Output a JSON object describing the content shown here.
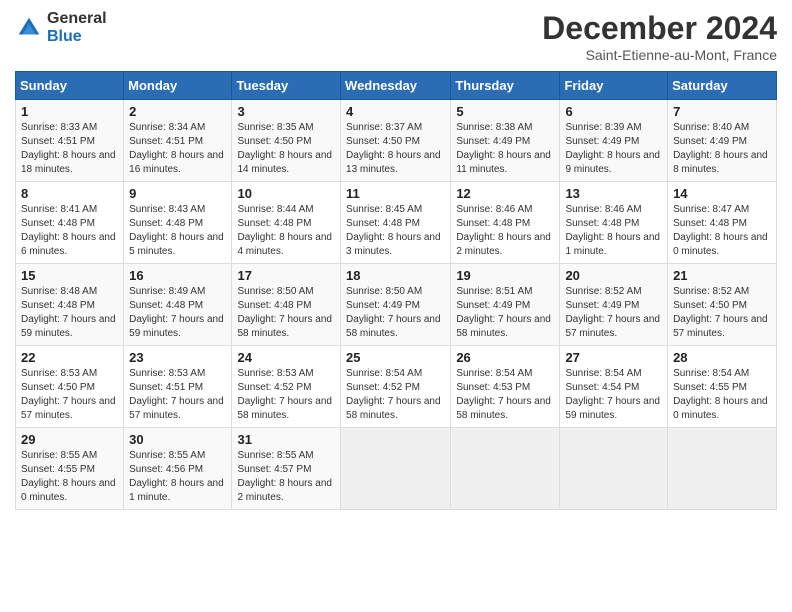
{
  "header": {
    "logo_general": "General",
    "logo_blue": "Blue",
    "month": "December 2024",
    "location": "Saint-Etienne-au-Mont, France"
  },
  "weekdays": [
    "Sunday",
    "Monday",
    "Tuesday",
    "Wednesday",
    "Thursday",
    "Friday",
    "Saturday"
  ],
  "weeks": [
    [
      {
        "day": "1",
        "sunrise": "Sunrise: 8:33 AM",
        "sunset": "Sunset: 4:51 PM",
        "daylight": "Daylight: 8 hours and 18 minutes."
      },
      {
        "day": "2",
        "sunrise": "Sunrise: 8:34 AM",
        "sunset": "Sunset: 4:51 PM",
        "daylight": "Daylight: 8 hours and 16 minutes."
      },
      {
        "day": "3",
        "sunrise": "Sunrise: 8:35 AM",
        "sunset": "Sunset: 4:50 PM",
        "daylight": "Daylight: 8 hours and 14 minutes."
      },
      {
        "day": "4",
        "sunrise": "Sunrise: 8:37 AM",
        "sunset": "Sunset: 4:50 PM",
        "daylight": "Daylight: 8 hours and 13 minutes."
      },
      {
        "day": "5",
        "sunrise": "Sunrise: 8:38 AM",
        "sunset": "Sunset: 4:49 PM",
        "daylight": "Daylight: 8 hours and 11 minutes."
      },
      {
        "day": "6",
        "sunrise": "Sunrise: 8:39 AM",
        "sunset": "Sunset: 4:49 PM",
        "daylight": "Daylight: 8 hours and 9 minutes."
      },
      {
        "day": "7",
        "sunrise": "Sunrise: 8:40 AM",
        "sunset": "Sunset: 4:49 PM",
        "daylight": "Daylight: 8 hours and 8 minutes."
      }
    ],
    [
      {
        "day": "8",
        "sunrise": "Sunrise: 8:41 AM",
        "sunset": "Sunset: 4:48 PM",
        "daylight": "Daylight: 8 hours and 6 minutes."
      },
      {
        "day": "9",
        "sunrise": "Sunrise: 8:43 AM",
        "sunset": "Sunset: 4:48 PM",
        "daylight": "Daylight: 8 hours and 5 minutes."
      },
      {
        "day": "10",
        "sunrise": "Sunrise: 8:44 AM",
        "sunset": "Sunset: 4:48 PM",
        "daylight": "Daylight: 8 hours and 4 minutes."
      },
      {
        "day": "11",
        "sunrise": "Sunrise: 8:45 AM",
        "sunset": "Sunset: 4:48 PM",
        "daylight": "Daylight: 8 hours and 3 minutes."
      },
      {
        "day": "12",
        "sunrise": "Sunrise: 8:46 AM",
        "sunset": "Sunset: 4:48 PM",
        "daylight": "Daylight: 8 hours and 2 minutes."
      },
      {
        "day": "13",
        "sunrise": "Sunrise: 8:46 AM",
        "sunset": "Sunset: 4:48 PM",
        "daylight": "Daylight: 8 hours and 1 minute."
      },
      {
        "day": "14",
        "sunrise": "Sunrise: 8:47 AM",
        "sunset": "Sunset: 4:48 PM",
        "daylight": "Daylight: 8 hours and 0 minutes."
      }
    ],
    [
      {
        "day": "15",
        "sunrise": "Sunrise: 8:48 AM",
        "sunset": "Sunset: 4:48 PM",
        "daylight": "Daylight: 7 hours and 59 minutes."
      },
      {
        "day": "16",
        "sunrise": "Sunrise: 8:49 AM",
        "sunset": "Sunset: 4:48 PM",
        "daylight": "Daylight: 7 hours and 59 minutes."
      },
      {
        "day": "17",
        "sunrise": "Sunrise: 8:50 AM",
        "sunset": "Sunset: 4:48 PM",
        "daylight": "Daylight: 7 hours and 58 minutes."
      },
      {
        "day": "18",
        "sunrise": "Sunrise: 8:50 AM",
        "sunset": "Sunset: 4:49 PM",
        "daylight": "Daylight: 7 hours and 58 minutes."
      },
      {
        "day": "19",
        "sunrise": "Sunrise: 8:51 AM",
        "sunset": "Sunset: 4:49 PM",
        "daylight": "Daylight: 7 hours and 58 minutes."
      },
      {
        "day": "20",
        "sunrise": "Sunrise: 8:52 AM",
        "sunset": "Sunset: 4:49 PM",
        "daylight": "Daylight: 7 hours and 57 minutes."
      },
      {
        "day": "21",
        "sunrise": "Sunrise: 8:52 AM",
        "sunset": "Sunset: 4:50 PM",
        "daylight": "Daylight: 7 hours and 57 minutes."
      }
    ],
    [
      {
        "day": "22",
        "sunrise": "Sunrise: 8:53 AM",
        "sunset": "Sunset: 4:50 PM",
        "daylight": "Daylight: 7 hours and 57 minutes."
      },
      {
        "day": "23",
        "sunrise": "Sunrise: 8:53 AM",
        "sunset": "Sunset: 4:51 PM",
        "daylight": "Daylight: 7 hours and 57 minutes."
      },
      {
        "day": "24",
        "sunrise": "Sunrise: 8:53 AM",
        "sunset": "Sunset: 4:52 PM",
        "daylight": "Daylight: 7 hours and 58 minutes."
      },
      {
        "day": "25",
        "sunrise": "Sunrise: 8:54 AM",
        "sunset": "Sunset: 4:52 PM",
        "daylight": "Daylight: 7 hours and 58 minutes."
      },
      {
        "day": "26",
        "sunrise": "Sunrise: 8:54 AM",
        "sunset": "Sunset: 4:53 PM",
        "daylight": "Daylight: 7 hours and 58 minutes."
      },
      {
        "day": "27",
        "sunrise": "Sunrise: 8:54 AM",
        "sunset": "Sunset: 4:54 PM",
        "daylight": "Daylight: 7 hours and 59 minutes."
      },
      {
        "day": "28",
        "sunrise": "Sunrise: 8:54 AM",
        "sunset": "Sunset: 4:55 PM",
        "daylight": "Daylight: 8 hours and 0 minutes."
      }
    ],
    [
      {
        "day": "29",
        "sunrise": "Sunrise: 8:55 AM",
        "sunset": "Sunset: 4:55 PM",
        "daylight": "Daylight: 8 hours and 0 minutes."
      },
      {
        "day": "30",
        "sunrise": "Sunrise: 8:55 AM",
        "sunset": "Sunset: 4:56 PM",
        "daylight": "Daylight: 8 hours and 1 minute."
      },
      {
        "day": "31",
        "sunrise": "Sunrise: 8:55 AM",
        "sunset": "Sunset: 4:57 PM",
        "daylight": "Daylight: 8 hours and 2 minutes."
      },
      null,
      null,
      null,
      null
    ]
  ]
}
